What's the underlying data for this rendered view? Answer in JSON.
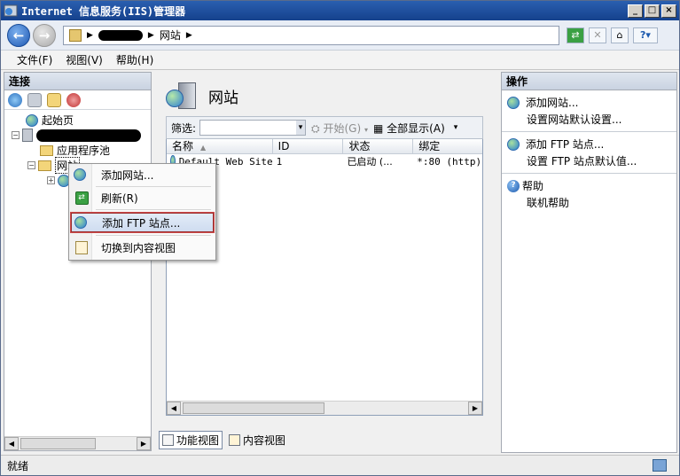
{
  "window": {
    "title": "Internet 信息服务(IIS)管理器"
  },
  "address": {
    "crumb_site": "网站"
  },
  "menu": [
    {
      "label": "文件(F)"
    },
    {
      "label": "视图(V)"
    },
    {
      "label": "帮助(H)"
    }
  ],
  "connections": {
    "header": "连接",
    "tree": {
      "start_page": "起始页",
      "app_pools": "应用程序池",
      "sites": "网站"
    }
  },
  "center": {
    "title": "网站",
    "filter_label": "筛选:",
    "start_label": "开始(G)",
    "show_all_label": "全部显示(A)",
    "columns": [
      "名称",
      "ID",
      "状态",
      "绑定"
    ],
    "rows": [
      {
        "name": "Default Web Site",
        "id": "1",
        "status": "已启动 (...",
        "binding": "*:80 (http),"
      }
    ],
    "tabs": {
      "feature_view": "功能视图",
      "content_view": "内容视图"
    }
  },
  "actions": {
    "header": "操作",
    "groups": [
      {
        "items": [
          "添加网站...",
          "设置网站默认设置..."
        ]
      },
      {
        "items": [
          "添加 FTP 站点...",
          "设置 FTP 站点默认值..."
        ]
      },
      {
        "items": [
          "帮助",
          "联机帮助"
        ]
      }
    ]
  },
  "context_menu": {
    "items": [
      "添加网站...",
      "刷新(R)",
      "添加 FTP 站点...",
      "切换到内容视图"
    ],
    "highlighted_index": 2
  },
  "status": {
    "text": "就绪"
  },
  "colors": {
    "title_bar": "#2a5fb0",
    "highlight_border": "#9a2e2e"
  }
}
